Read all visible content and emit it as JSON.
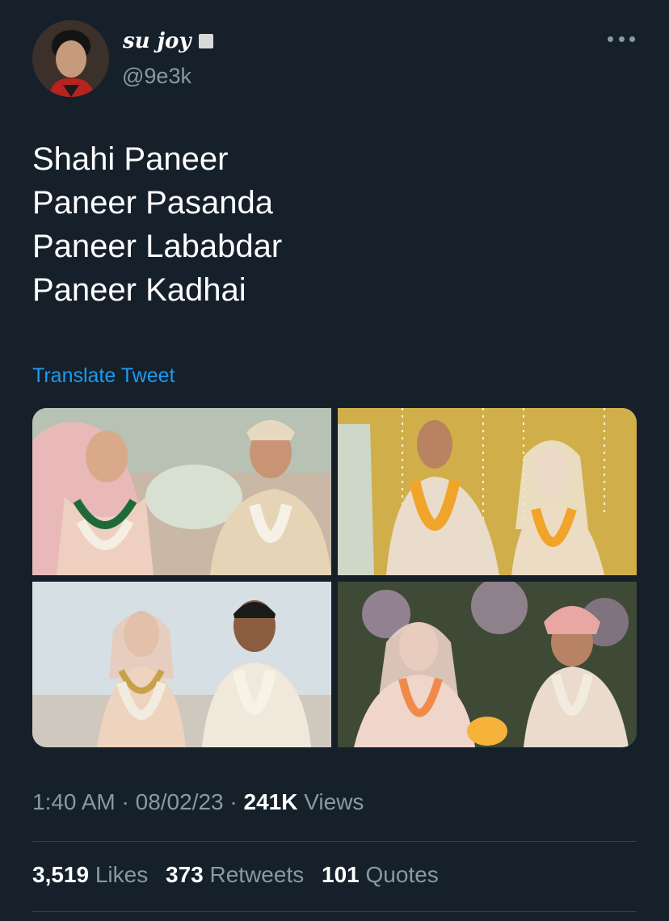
{
  "author": {
    "display_name": "su joy",
    "handle": "@9e3k"
  },
  "tweet": {
    "lines": [
      "Shahi Paneer",
      "Paneer Pasanda",
      "Paneer Lababdar",
      "Paneer Kadhai"
    ],
    "translate_label": "Translate Tweet"
  },
  "meta": {
    "time": "1:40 AM",
    "separator": " · ",
    "date": "08/02/23",
    "views_count": "241K",
    "views_label": "Views"
  },
  "stats": {
    "likes_count": "3,519",
    "likes_label": "Likes",
    "retweets_count": "373",
    "retweets_label": "Retweets",
    "quotes_count": "101",
    "quotes_label": "Quotes"
  },
  "icons": {
    "more": "more-horizontal-icon",
    "badge": "verified-badge-icon"
  },
  "colors": {
    "background": "#15202b",
    "text": "#ffffff",
    "secondary": "#8899a6",
    "link": "#1d9bf0",
    "divider": "#38444d"
  }
}
